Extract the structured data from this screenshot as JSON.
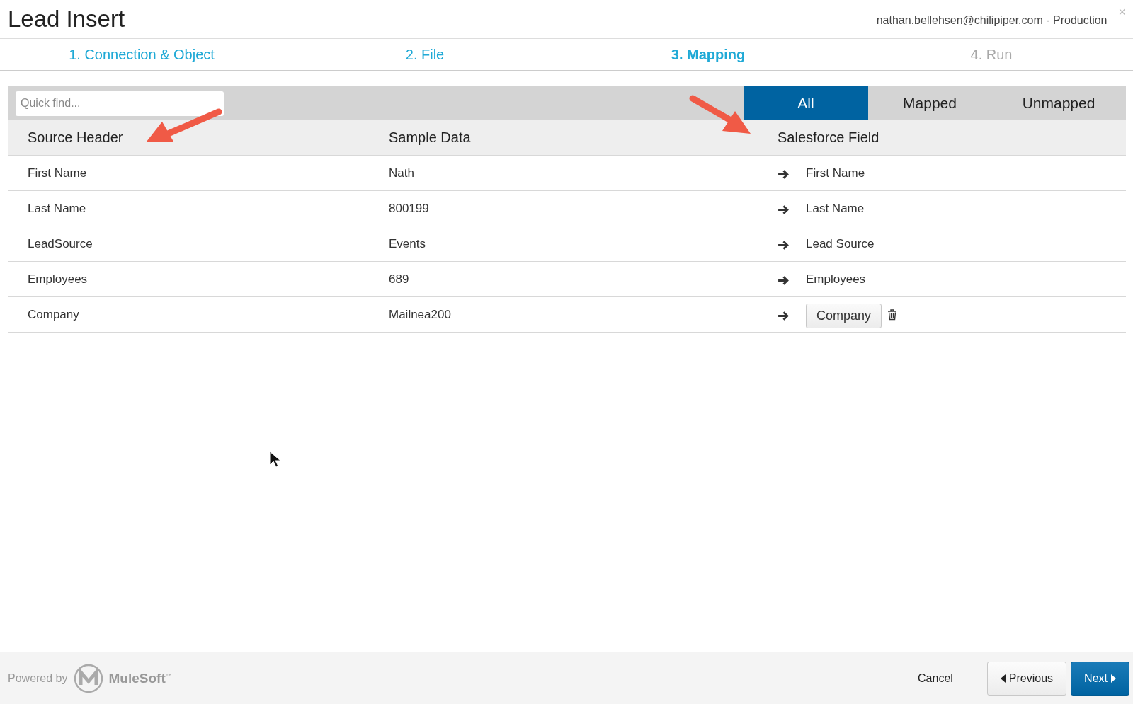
{
  "window": {
    "title": "Lead Insert",
    "account": "nathan.bellehsen@chilipiper.com - Production",
    "close": "×"
  },
  "steps": [
    {
      "label": "1. Connection & Object",
      "selected": false,
      "disabled": false
    },
    {
      "label": "2. File",
      "selected": false,
      "disabled": false
    },
    {
      "label": "3. Mapping",
      "selected": true,
      "disabled": false
    },
    {
      "label": "4. Run",
      "selected": false,
      "disabled": true
    }
  ],
  "search": {
    "placeholder": "Quick find..."
  },
  "filters": [
    {
      "label": "All",
      "selected": true
    },
    {
      "label": "Mapped",
      "selected": false
    },
    {
      "label": "Unmapped",
      "selected": false
    }
  ],
  "table": {
    "columns": [
      "Source Header",
      "Sample Data",
      "Salesforce Field"
    ],
    "rows": [
      {
        "source": "First Name",
        "sample": "Nath",
        "field": "First Name",
        "kind": "text"
      },
      {
        "source": "Last Name",
        "sample": "800199",
        "field": "Last Name",
        "kind": "text"
      },
      {
        "source": "LeadSource",
        "sample": "Events",
        "field": "Lead Source",
        "kind": "text"
      },
      {
        "source": "Employees",
        "sample": "689",
        "field": "Employees",
        "kind": "text"
      },
      {
        "source": "Company",
        "sample": "Mailnea200",
        "field": "Company",
        "kind": "button"
      }
    ]
  },
  "footer": {
    "powered_by": "Powered by",
    "logo_text": "MuleSoft$^{™}$",
    "buttons": [
      {
        "label": "Cancel",
        "kind": "link"
      },
      {
        "label": "Previous",
        "kind": "back"
      },
      {
        "label": "Next",
        "kind": "primary"
      }
    ]
  }
}
